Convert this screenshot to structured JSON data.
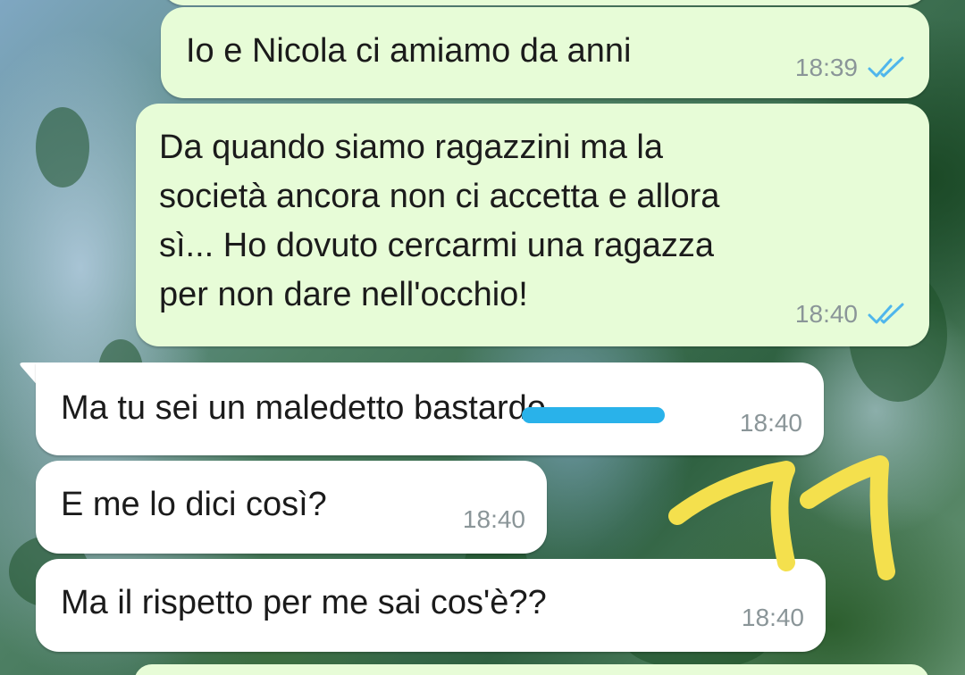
{
  "wallpaper": {
    "description_icon": "mountain-forest-wallpaper"
  },
  "messages": [
    {
      "direction": "outgoing",
      "text": "Io e Nicola ci amiamo da anni",
      "time": "18:39",
      "status_icon": "double-check-read-icon"
    },
    {
      "direction": "outgoing",
      "text": "Da quando siamo ragazzini ma la\nsocietà ancora non ci accetta e allora\nsì... Ho dovuto cercarmi una ragazza\nper non dare nell'occhio!",
      "time": "18:40",
      "status_icon": "double-check-read-icon"
    },
    {
      "direction": "incoming",
      "text": "Ma tu sei un maledetto bastardo",
      "time": "18:40",
      "redacted_word": "bastardo"
    },
    {
      "direction": "incoming",
      "text": "E me lo dici così?",
      "time": "18:40"
    },
    {
      "direction": "incoming",
      "text": "Ma il rispetto per me sai cos'è??",
      "time": "18:40"
    }
  ],
  "colors": {
    "outgoing_bubble": "#e7fcd7",
    "incoming_bubble": "#ffffff",
    "read_ticks": "#4fb6ec",
    "timestamp": "#8a9598",
    "redaction_marker": "#29b2ea",
    "annotation_scribble": "#f4e04d"
  },
  "annotation": {
    "icon": "yellow-double-exclamation-scribble"
  }
}
